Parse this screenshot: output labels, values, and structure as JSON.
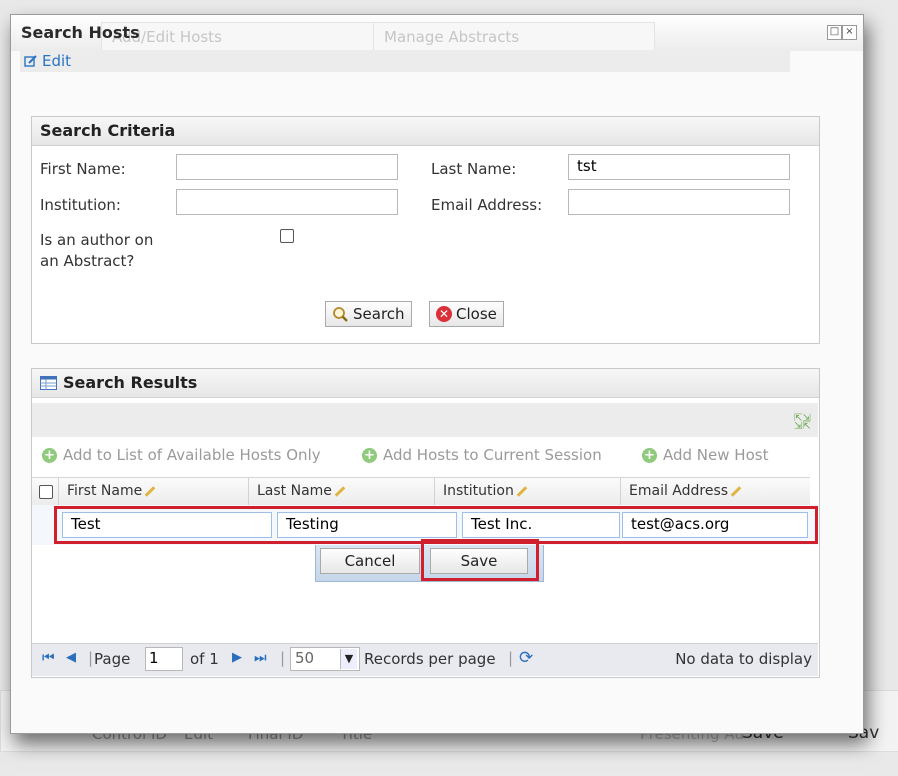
{
  "dialog": {
    "title": "Search Hosts",
    "ghost_tabs": [
      "Add/Edit Hosts",
      "Manage Abstracts"
    ],
    "edit_label": "Edit"
  },
  "search_criteria": {
    "heading": "Search Criteria",
    "first_name_label": "First Name:",
    "first_name_value": "",
    "last_name_label": "Last Name:",
    "last_name_value": "tst",
    "institution_label": "Institution:",
    "institution_value": "",
    "email_label": "Email Address:",
    "email_value": "",
    "author_label_line1": "Is an author on",
    "author_label_line2": "an Abstract?",
    "search_button": "Search",
    "close_button": "Close"
  },
  "search_results": {
    "heading": "Search Results",
    "actions": [
      "Add to List of Available Hosts Only",
      "Add Hosts to Current Session",
      "Add New Host"
    ],
    "columns": [
      "First Name",
      "Last Name",
      "Institution",
      "Email Address"
    ],
    "row": {
      "first_name": "Test",
      "last_name": "Testing",
      "institution": "Test Inc.",
      "email": "test@acs.org"
    },
    "cancel_button": "Cancel",
    "save_button": "Save"
  },
  "pager": {
    "page_label": "Page",
    "page_value": "1",
    "of_label": "of 1",
    "page_size": "50",
    "records_label": "Records per page",
    "status": "No data to display"
  },
  "background": {
    "bottom_texts": [
      "Control ID",
      "Edit",
      "Final ID",
      "Title",
      "Presenting Au",
      "Save",
      "Sav"
    ]
  },
  "colors": {
    "highlight": "#d0202e",
    "link": "#2a74c4"
  }
}
